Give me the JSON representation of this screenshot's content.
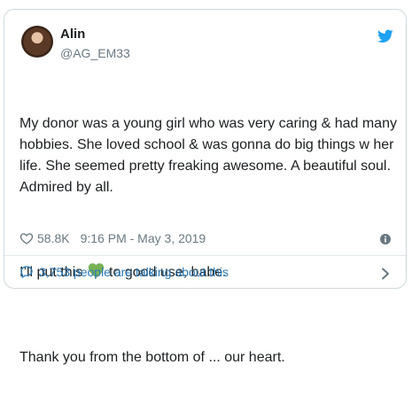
{
  "tweet": {
    "author_name": "Alin",
    "author_handle": "@AG_EM33",
    "paragraphs": [
      "My donor was a young girl who was very caring & had many hobbies. She loved school & was gonna do big things w her life. She seemed pretty freaking awesome. A beautiful soul. Admired by all.",
      [
        "I’ll put this ",
        " to good use, babe."
      ],
      "Thank you from the bottom of ... our heart."
    ],
    "likes": "58.8K",
    "timestamp": "9:16 PM - May 3, 2019",
    "talking": "3,753 people are talking about this"
  },
  "icons": {
    "bird": "twitter-bird-icon",
    "heart": "heart-icon",
    "info": "info-icon",
    "bubble": "speech-bubble-icon",
    "chevron": "chevron-right-icon",
    "emoji": "green-heart-emoji"
  },
  "colors": {
    "brand": "#1da1f2",
    "link": "#2b7bb9",
    "muted": "#697882",
    "emoji_green": "#77b255"
  }
}
